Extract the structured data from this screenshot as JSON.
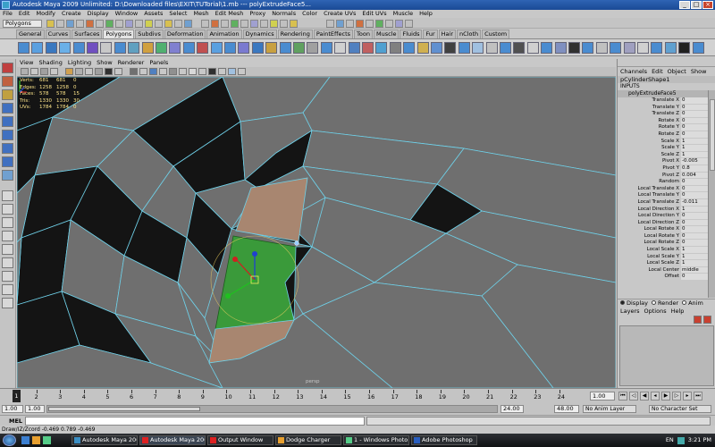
{
  "window": {
    "title": "Autodesk Maya 2009 Unlimited: D:\\Downloaded files\\EXIT\\TUTorial\\1.mb   ---   polyExtrudeFace5..."
  },
  "menubar": [
    "File",
    "Edit",
    "Modify",
    "Create",
    "Display",
    "Window",
    "Assets",
    "Select",
    "Mesh",
    "Edit Mesh",
    "Proxy",
    "Normals",
    "Color",
    "Create UVs",
    "Edit UVs",
    "Muscle",
    "Help"
  ],
  "statusline": {
    "mode": "Polygons"
  },
  "shelf": {
    "tabs": [
      "General",
      "Curves",
      "Surfaces",
      "Polygons",
      "Subdivs",
      "Deformation",
      "Animation",
      "Dynamics",
      "Rendering",
      "PaintEffects",
      "Toon",
      "Muscle",
      "Fluids",
      "Fur",
      "Hair",
      "nCloth",
      "Custom"
    ],
    "active_tab": "Polygons"
  },
  "panel": {
    "menu": [
      "View",
      "Shading",
      "Lighting",
      "Show",
      "Renderer",
      "Panels"
    ],
    "camera": "persp"
  },
  "hud": {
    "rows": [
      {
        "label": "Verts:",
        "a": "681",
        "b": "681",
        "c": "0"
      },
      {
        "label": "Edges:",
        "a": "1258",
        "b": "1258",
        "c": "0"
      },
      {
        "label": "Faces:",
        "a": "578",
        "b": "578",
        "c": "15"
      },
      {
        "label": "Tris:",
        "a": "1330",
        "b": "1330",
        "c": "30"
      },
      {
        "label": "UVs:",
        "a": "1784",
        "b": "1784",
        "c": "0"
      }
    ]
  },
  "channel_box": {
    "title": "",
    "menu": [
      "Channels",
      "Edit",
      "Object",
      "Show"
    ],
    "object": "pCylinderShape1",
    "inputs_label": "INPUTS",
    "node": "polyExtrudeFace5",
    "attributes": [
      {
        "name": "Translate X",
        "value": "0"
      },
      {
        "name": "Translate Y",
        "value": "0"
      },
      {
        "name": "Translate Z",
        "value": "0"
      },
      {
        "name": "Rotate X",
        "value": "0"
      },
      {
        "name": "Rotate Y",
        "value": "0"
      },
      {
        "name": "Rotate Z",
        "value": "0"
      },
      {
        "name": "Scale X",
        "value": "1"
      },
      {
        "name": "Scale Y",
        "value": "1"
      },
      {
        "name": "Scale Z",
        "value": "1"
      },
      {
        "name": "Pivot X",
        "value": "-0.005"
      },
      {
        "name": "Pivot Y",
        "value": "0.8"
      },
      {
        "name": "Pivot Z",
        "value": "0.004"
      },
      {
        "name": "Random",
        "value": "0"
      },
      {
        "name": "Local Translate X",
        "value": "0"
      },
      {
        "name": "Local Translate Y",
        "value": "0"
      },
      {
        "name": "Local Translate Z",
        "value": "-0.011"
      },
      {
        "name": "Local Direction X",
        "value": "1"
      },
      {
        "name": "Local Direction Y",
        "value": "0"
      },
      {
        "name": "Local Direction Z",
        "value": "0"
      },
      {
        "name": "Local Rotate X",
        "value": "0"
      },
      {
        "name": "Local Rotate Y",
        "value": "0"
      },
      {
        "name": "Local Rotate Z",
        "value": "0"
      },
      {
        "name": "Local Scale X",
        "value": "1"
      },
      {
        "name": "Local Scale Y",
        "value": "1"
      },
      {
        "name": "Local Scale Z",
        "value": "1"
      },
      {
        "name": "Local Center",
        "value": "middle"
      },
      {
        "name": "Offset",
        "value": "0"
      }
    ]
  },
  "layer_editor": {
    "tabs": [
      "Display",
      "Render",
      "Anim"
    ],
    "selected_tab": "Display",
    "menu": [
      "Layers",
      "Options",
      "Help"
    ]
  },
  "time_slider": {
    "current_frame": "1",
    "ticks": [
      "1",
      "2",
      "3",
      "4",
      "5",
      "6",
      "7",
      "8",
      "9",
      "10",
      "11",
      "12",
      "13",
      "14",
      "15",
      "16",
      "17",
      "18",
      "19",
      "20",
      "21",
      "22",
      "23",
      "24"
    ],
    "current_field": "1.00"
  },
  "range_slider": {
    "start": "1.00",
    "playback_start": "1.00",
    "playback_end": "24.00",
    "end": "48.00",
    "anim_layer": "No Anim Layer",
    "character_set": "No Character Set"
  },
  "mel": {
    "label": "MEL"
  },
  "help_line": "Draw/IZ/Zcord   -0.469        0.789       -0.469",
  "taskbar": {
    "buttons": [
      {
        "label": "Autodesk Maya 200...",
        "color": "#3c8fc4"
      },
      {
        "label": "Autodesk Maya 200...",
        "color": "#d22"
      },
      {
        "label": "Output Window",
        "color": "#d22"
      },
      {
        "label": "Dodge Charger",
        "color": "#e8a030"
      },
      {
        "label": "1 - Windows Photo ...",
        "color": "#5c8"
      },
      {
        "label": "Adobe Photoshop",
        "color": "#2a5fc0"
      }
    ],
    "language": "EN",
    "clock": "3:21 PM"
  },
  "colors": {
    "selection": "#3a9a3a",
    "wire": "#6fd0e8",
    "face_highlight": "#a88670",
    "viewport_bg": "#6f6f6f"
  }
}
